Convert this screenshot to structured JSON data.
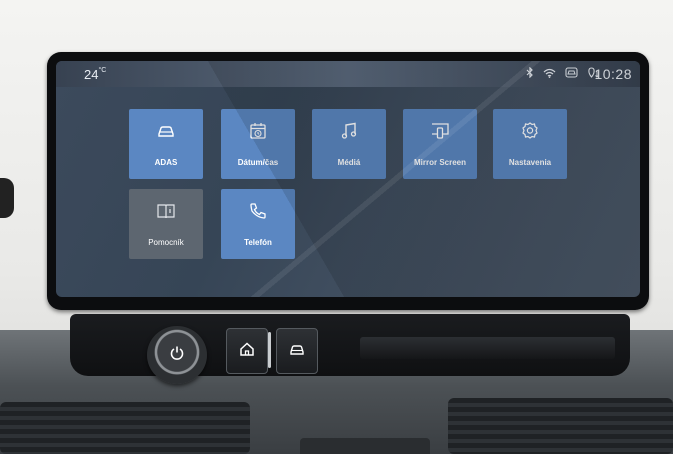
{
  "status_bar": {
    "temperature": "24",
    "temperature_unit": "°C",
    "clock": "10:28",
    "icons": [
      "bluetooth-icon",
      "wifi-icon",
      "car-connect-icon",
      "location-icon"
    ]
  },
  "apps": [
    {
      "label": "ADAS",
      "icon": "car-icon",
      "color": "#5b87c2"
    },
    {
      "label": "Dátum/čas",
      "icon": "calendar-clock-icon",
      "color": "#5b87c2"
    },
    {
      "label": "Médiá",
      "icon": "music-note-icon",
      "color": "#5b87c2"
    },
    {
      "label": "Mirror Screen",
      "icon": "phone-mirror-icon",
      "color": "#5b87c2"
    },
    {
      "label": "Nastavenia",
      "icon": "gear-icon",
      "color": "#5b87c2"
    },
    {
      "label": "Pomocník",
      "icon": "book-info-icon",
      "color": "#5d6670"
    },
    {
      "label": "Telefón",
      "icon": "phone-icon",
      "color": "#5b87c2"
    }
  ],
  "hardware_controls": [
    "power-volume-knob",
    "home-button",
    "vehicle-button"
  ]
}
